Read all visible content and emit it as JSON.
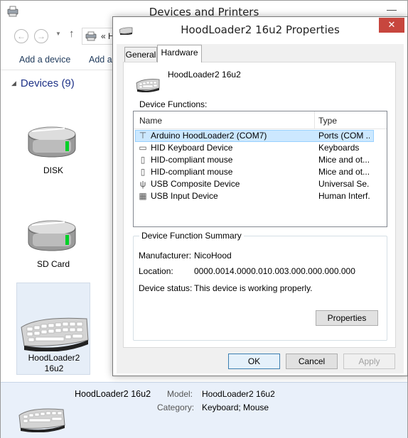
{
  "background_window": {
    "title": "Devices and Printers",
    "minimize_glyph": "—",
    "address": {
      "crumb_separator": "«",
      "crumb_partial": "H"
    },
    "toolbar": {
      "add_device_label": "Add a device",
      "add_printer_label": "Add a"
    },
    "devices_group": {
      "label": "Devices (9)"
    },
    "tiles": [
      {
        "label": "DISK"
      },
      {
        "label": "SD Card"
      },
      {
        "label": "HoodLoader2\n16u2"
      }
    ],
    "details": {
      "name": "HoodLoader2 16u2",
      "model_label": "Model:",
      "model_value": "HoodLoader2 16u2",
      "category_label": "Category:",
      "category_value": "Keyboard; Mouse"
    }
  },
  "dialog": {
    "title": "HoodLoader2 16u2 Properties",
    "close_glyph": "✕",
    "tabs": {
      "general": "General",
      "hardware": "Hardware"
    },
    "device_name": "HoodLoader2 16u2",
    "functions_label": "Device Functions:",
    "columns": {
      "name": "Name",
      "type": "Type"
    },
    "functions": [
      {
        "name": "Arduino HoodLoader2 (COM7)",
        "type": "Ports (COM ...",
        "icon": "serial-port-icon",
        "glyph": "⊤"
      },
      {
        "name": "HID Keyboard Device",
        "type": "Keyboards",
        "icon": "keyboard-icon",
        "glyph": "▭"
      },
      {
        "name": "HID-compliant mouse",
        "type": "Mice and ot...",
        "icon": "mouse-icon",
        "glyph": "▯"
      },
      {
        "name": "HID-compliant mouse",
        "type": "Mice and ot...",
        "icon": "mouse-icon",
        "glyph": "▯"
      },
      {
        "name": "USB Composite Device",
        "type": "Universal Se...",
        "icon": "usb-icon",
        "glyph": "ψ"
      },
      {
        "name": "USB Input Device",
        "type": "Human Interf...",
        "icon": "input-device-icon",
        "glyph": "▦"
      }
    ],
    "summary": {
      "legend": "Device Function Summary",
      "manufacturer_label": "Manufacturer:",
      "manufacturer_value": "NicoHood",
      "location_label": "Location:",
      "location_value": "0000.0014.0000.010.003.000.000.000.000",
      "status_label": "Device status:",
      "status_value": "This device is working properly.",
      "properties_button": "Properties"
    },
    "buttons": {
      "ok": "OK",
      "cancel": "Cancel",
      "apply": "Apply"
    }
  }
}
